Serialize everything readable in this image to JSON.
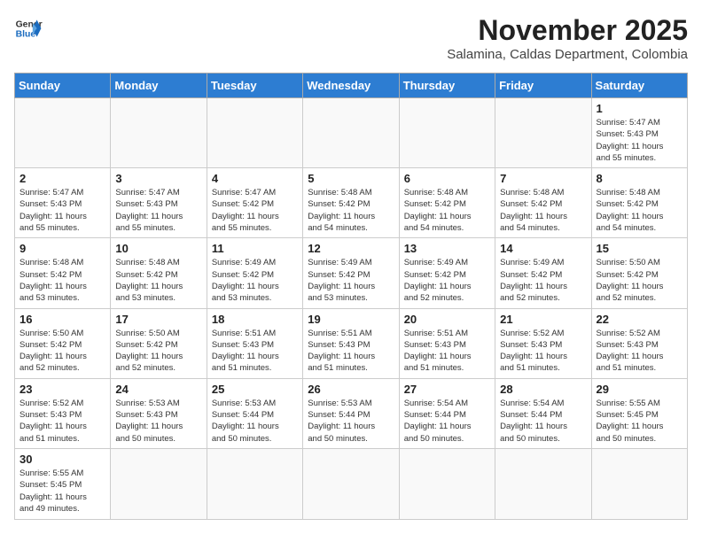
{
  "logo": {
    "line1": "General",
    "line2": "Blue"
  },
  "header": {
    "month": "November 2025",
    "location": "Salamina, Caldas Department, Colombia"
  },
  "weekdays": [
    "Sunday",
    "Monday",
    "Tuesday",
    "Wednesday",
    "Thursday",
    "Friday",
    "Saturday"
  ],
  "weeks": [
    [
      {
        "day": "",
        "info": ""
      },
      {
        "day": "",
        "info": ""
      },
      {
        "day": "",
        "info": ""
      },
      {
        "day": "",
        "info": ""
      },
      {
        "day": "",
        "info": ""
      },
      {
        "day": "",
        "info": ""
      },
      {
        "day": "1",
        "info": "Sunrise: 5:47 AM\nSunset: 5:43 PM\nDaylight: 11 hours\nand 55 minutes."
      }
    ],
    [
      {
        "day": "2",
        "info": "Sunrise: 5:47 AM\nSunset: 5:43 PM\nDaylight: 11 hours\nand 55 minutes."
      },
      {
        "day": "3",
        "info": "Sunrise: 5:47 AM\nSunset: 5:43 PM\nDaylight: 11 hours\nand 55 minutes."
      },
      {
        "day": "4",
        "info": "Sunrise: 5:47 AM\nSunset: 5:42 PM\nDaylight: 11 hours\nand 55 minutes."
      },
      {
        "day": "5",
        "info": "Sunrise: 5:48 AM\nSunset: 5:42 PM\nDaylight: 11 hours\nand 54 minutes."
      },
      {
        "day": "6",
        "info": "Sunrise: 5:48 AM\nSunset: 5:42 PM\nDaylight: 11 hours\nand 54 minutes."
      },
      {
        "day": "7",
        "info": "Sunrise: 5:48 AM\nSunset: 5:42 PM\nDaylight: 11 hours\nand 54 minutes."
      },
      {
        "day": "8",
        "info": "Sunrise: 5:48 AM\nSunset: 5:42 PM\nDaylight: 11 hours\nand 54 minutes."
      }
    ],
    [
      {
        "day": "9",
        "info": "Sunrise: 5:48 AM\nSunset: 5:42 PM\nDaylight: 11 hours\nand 53 minutes."
      },
      {
        "day": "10",
        "info": "Sunrise: 5:48 AM\nSunset: 5:42 PM\nDaylight: 11 hours\nand 53 minutes."
      },
      {
        "day": "11",
        "info": "Sunrise: 5:49 AM\nSunset: 5:42 PM\nDaylight: 11 hours\nand 53 minutes."
      },
      {
        "day": "12",
        "info": "Sunrise: 5:49 AM\nSunset: 5:42 PM\nDaylight: 11 hours\nand 53 minutes."
      },
      {
        "day": "13",
        "info": "Sunrise: 5:49 AM\nSunset: 5:42 PM\nDaylight: 11 hours\nand 52 minutes."
      },
      {
        "day": "14",
        "info": "Sunrise: 5:49 AM\nSunset: 5:42 PM\nDaylight: 11 hours\nand 52 minutes."
      },
      {
        "day": "15",
        "info": "Sunrise: 5:50 AM\nSunset: 5:42 PM\nDaylight: 11 hours\nand 52 minutes."
      }
    ],
    [
      {
        "day": "16",
        "info": "Sunrise: 5:50 AM\nSunset: 5:42 PM\nDaylight: 11 hours\nand 52 minutes."
      },
      {
        "day": "17",
        "info": "Sunrise: 5:50 AM\nSunset: 5:42 PM\nDaylight: 11 hours\nand 52 minutes."
      },
      {
        "day": "18",
        "info": "Sunrise: 5:51 AM\nSunset: 5:43 PM\nDaylight: 11 hours\nand 51 minutes."
      },
      {
        "day": "19",
        "info": "Sunrise: 5:51 AM\nSunset: 5:43 PM\nDaylight: 11 hours\nand 51 minutes."
      },
      {
        "day": "20",
        "info": "Sunrise: 5:51 AM\nSunset: 5:43 PM\nDaylight: 11 hours\nand 51 minutes."
      },
      {
        "day": "21",
        "info": "Sunrise: 5:52 AM\nSunset: 5:43 PM\nDaylight: 11 hours\nand 51 minutes."
      },
      {
        "day": "22",
        "info": "Sunrise: 5:52 AM\nSunset: 5:43 PM\nDaylight: 11 hours\nand 51 minutes."
      }
    ],
    [
      {
        "day": "23",
        "info": "Sunrise: 5:52 AM\nSunset: 5:43 PM\nDaylight: 11 hours\nand 51 minutes."
      },
      {
        "day": "24",
        "info": "Sunrise: 5:53 AM\nSunset: 5:43 PM\nDaylight: 11 hours\nand 50 minutes."
      },
      {
        "day": "25",
        "info": "Sunrise: 5:53 AM\nSunset: 5:44 PM\nDaylight: 11 hours\nand 50 minutes."
      },
      {
        "day": "26",
        "info": "Sunrise: 5:53 AM\nSunset: 5:44 PM\nDaylight: 11 hours\nand 50 minutes."
      },
      {
        "day": "27",
        "info": "Sunrise: 5:54 AM\nSunset: 5:44 PM\nDaylight: 11 hours\nand 50 minutes."
      },
      {
        "day": "28",
        "info": "Sunrise: 5:54 AM\nSunset: 5:44 PM\nDaylight: 11 hours\nand 50 minutes."
      },
      {
        "day": "29",
        "info": "Sunrise: 5:55 AM\nSunset: 5:45 PM\nDaylight: 11 hours\nand 50 minutes."
      }
    ],
    [
      {
        "day": "30",
        "info": "Sunrise: 5:55 AM\nSunset: 5:45 PM\nDaylight: 11 hours\nand 49 minutes."
      },
      {
        "day": "",
        "info": ""
      },
      {
        "day": "",
        "info": ""
      },
      {
        "day": "",
        "info": ""
      },
      {
        "day": "",
        "info": ""
      },
      {
        "day": "",
        "info": ""
      },
      {
        "day": "",
        "info": ""
      }
    ]
  ]
}
